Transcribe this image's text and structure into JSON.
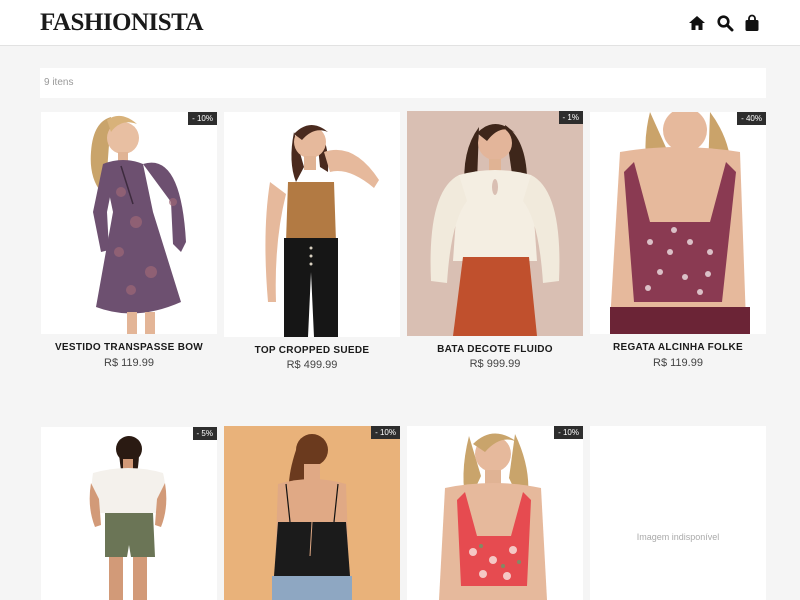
{
  "header": {
    "logo": "FASHIONISTA",
    "icons": [
      "home-icon",
      "search-icon",
      "shopping-bag-icon"
    ]
  },
  "listing": {
    "count": "9 itens"
  },
  "products": [
    {
      "name": "VESTIDO TRANSPASSE BOW",
      "price": "R$ 119.99",
      "discount": "- 10%"
    },
    {
      "name": "TOP CROPPED SUEDE",
      "price": "R$ 499.99",
      "discount": ""
    },
    {
      "name": "BATA DECOTE FLUIDO",
      "price": "R$ 999.99",
      "discount": "- 1%"
    },
    {
      "name": "REGATA ALCINHA FOLKE",
      "price": "R$ 119.99",
      "discount": "- 40%"
    },
    {
      "name": "",
      "price": "",
      "discount": "- 5%"
    },
    {
      "name": "",
      "price": "",
      "discount": "- 10%"
    },
    {
      "name": "",
      "price": "",
      "discount": "- 10%"
    },
    {
      "name": "",
      "price": "",
      "discount": "",
      "unavailable_text": "Imagem indisponível"
    }
  ],
  "colors": {
    "badge": "#2d2d2d",
    "header_bg": "#ffffff",
    "page_bg": "#f5f5f5"
  }
}
